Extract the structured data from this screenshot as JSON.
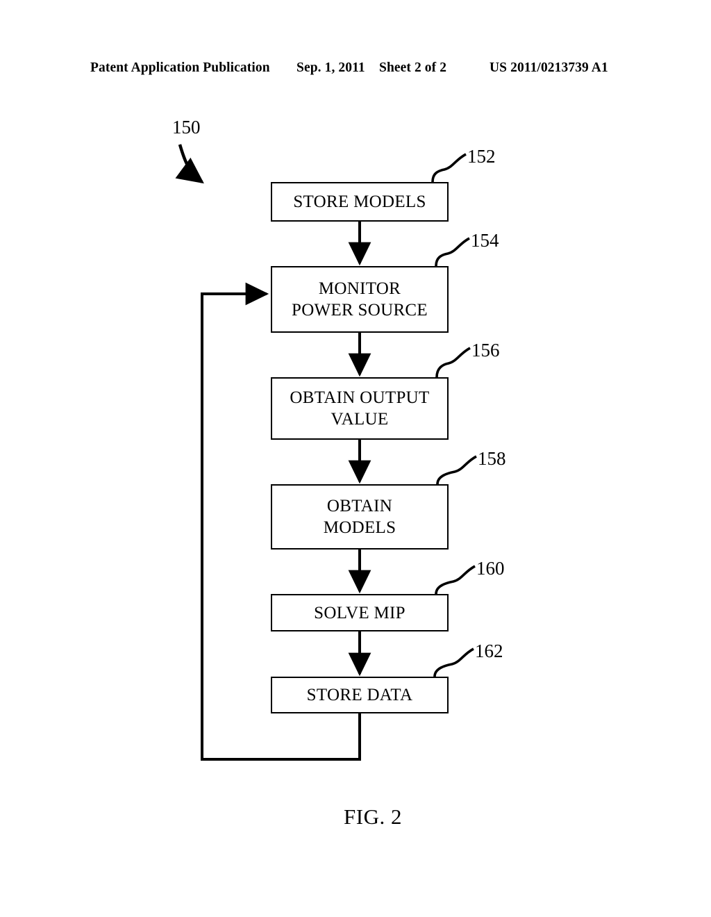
{
  "header": {
    "publication": "Patent Application Publication",
    "date": "Sep. 1, 2011",
    "sheet": "Sheet 2 of 2",
    "patent_number": "US 2011/0213739 A1"
  },
  "figure": {
    "caption": "FIG. 2",
    "diagram_reference": "150"
  },
  "flowchart": {
    "steps": [
      {
        "ref": "152",
        "label": "STORE MODELS"
      },
      {
        "ref": "154",
        "label": "MONITOR\nPOWER SOURCE"
      },
      {
        "ref": "156",
        "label": "OBTAIN OUTPUT\nVALUE"
      },
      {
        "ref": "158",
        "label": "OBTAIN\nMODELS"
      },
      {
        "ref": "160",
        "label": "SOLVE MIP"
      },
      {
        "ref": "162",
        "label": "STORE DATA"
      }
    ]
  },
  "colors": {
    "ink": "#000000",
    "paper": "#ffffff"
  }
}
